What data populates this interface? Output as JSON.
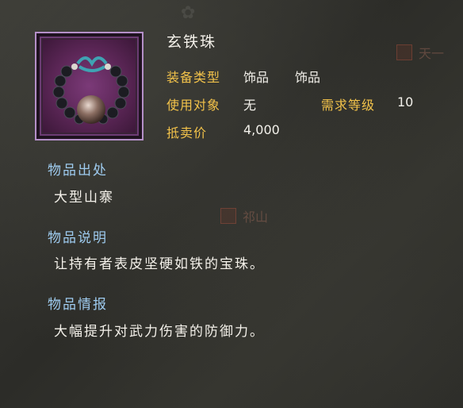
{
  "item": {
    "name": "玄铁珠",
    "icon": "bead-bracelet-icon",
    "rarity_color": "#b48fc8",
    "stats": {
      "equip_type_label": "装备类型",
      "equip_type_value_1": "饰品",
      "equip_type_value_2": "饰品",
      "target_label": "使用对象",
      "target_value": "无",
      "level_label": "需求等级",
      "level_value": "10",
      "price_label": "抵卖价",
      "price_value": "4,000"
    }
  },
  "sections": {
    "source_title": "物品出处",
    "source_body": "大型山寨",
    "desc_title": "物品说明",
    "desc_body": "让持有者表皮坚硬如铁的宝珠。",
    "info_title": "物品情报",
    "info_body": "大幅提升对武力伤害的防御力。"
  },
  "map": {
    "label_right": "天一",
    "label_mid": "祁山"
  },
  "colors": {
    "label": "#f2c24a",
    "section_title": "#9ecbef",
    "text": "#f2f0ea"
  }
}
